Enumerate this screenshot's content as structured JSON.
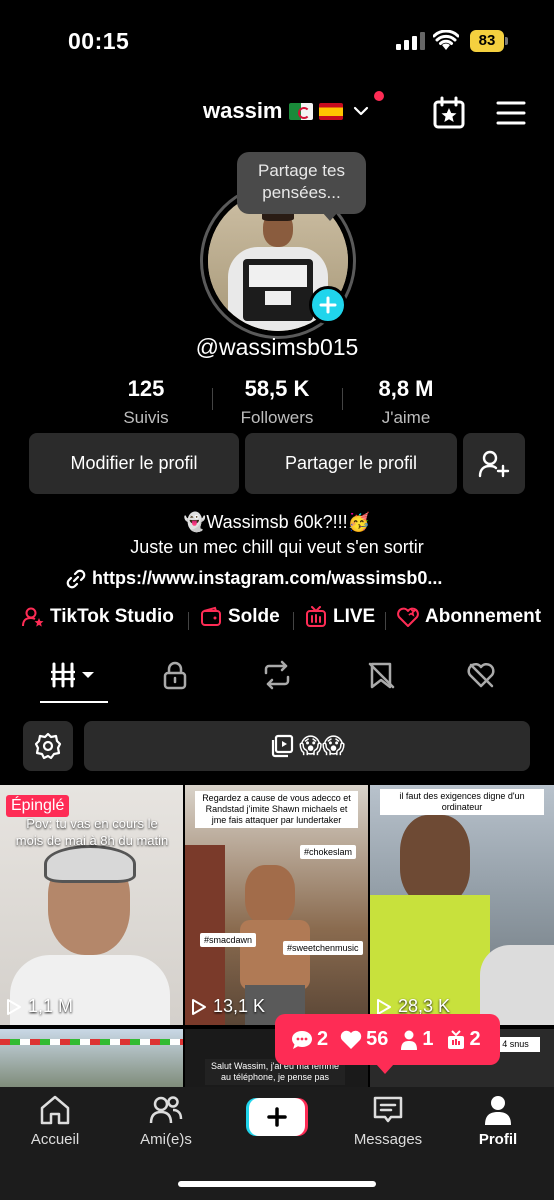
{
  "status_bar": {
    "time": "00:15",
    "battery": "83"
  },
  "header": {
    "username": "wassim",
    "flags": [
      "algeria-flag",
      "spain-flag"
    ]
  },
  "bubble": {
    "text_line1": "Partage tes",
    "text_line2": "pensées..."
  },
  "profile": {
    "handle": "@wassimsb015"
  },
  "stats": [
    {
      "value": "125",
      "label": "Suivis"
    },
    {
      "value": "58,5 K",
      "label": "Followers"
    },
    {
      "value": "8,8 M",
      "label": "J'aime"
    }
  ],
  "buttons": {
    "edit": "Modifier le profil",
    "share": "Partager le profil"
  },
  "bio": {
    "line1": "Wassimsb 60k?!!!",
    "line2": "Juste un mec chill qui veut s'en sortir",
    "link": "https://www.instagram.com/wassimsb0..."
  },
  "features": [
    {
      "label": "TikTok Studio",
      "icon": "studio-icon"
    },
    {
      "label": "Solde",
      "icon": "wallet-icon"
    },
    {
      "label": "LIVE",
      "icon": "live-icon"
    },
    {
      "label": "Abonnement",
      "icon": "subscription-icon"
    }
  ],
  "tabs": [
    "videos-grid-icon",
    "lock-icon",
    "repost-icon",
    "saved-icon",
    "liked-icon"
  ],
  "filter": {
    "emojis": "😱😱"
  },
  "grid": {
    "pinned_label": "Épinglé",
    "tile1_caption": "Pov: tu vas en cours le mois de mai à 8h du matin",
    "tile1_views": "1,1 M",
    "tile2_caption": "Regardez a cause de vous adecco et Randstad j'imite Shawn michaels et jme fais attaquer par lundertaker",
    "tile2_tags": [
      "#chokeslam",
      "#smacdawn",
      "#sweetchenmusic"
    ],
    "tile2_views": "13,1 K",
    "tile3_caption": "il faut des exigences digne d'un ordinateur",
    "tile3_views": "28,3 K",
    "tile5_caption": "Salut Wassim, j'ai eu ma femme au téléphone, je pense pas",
    "tile6_caption": "de clim 4 snus"
  },
  "notifications": {
    "comments": "2",
    "likes": "56",
    "followers": "1",
    "gifts": "2"
  },
  "nav": [
    {
      "label": "Accueil",
      "icon": "home-icon"
    },
    {
      "label": "Ami(e)s",
      "icon": "friends-icon"
    },
    {
      "label": "",
      "icon": "create-icon"
    },
    {
      "label": "Messages",
      "icon": "messages-icon"
    },
    {
      "label": "Profil",
      "icon": "profile-icon"
    }
  ],
  "colors": {
    "accent": "#fe2c55",
    "cyan": "#20d5ec",
    "background": "#000000",
    "surface": "#2b2b2b"
  }
}
